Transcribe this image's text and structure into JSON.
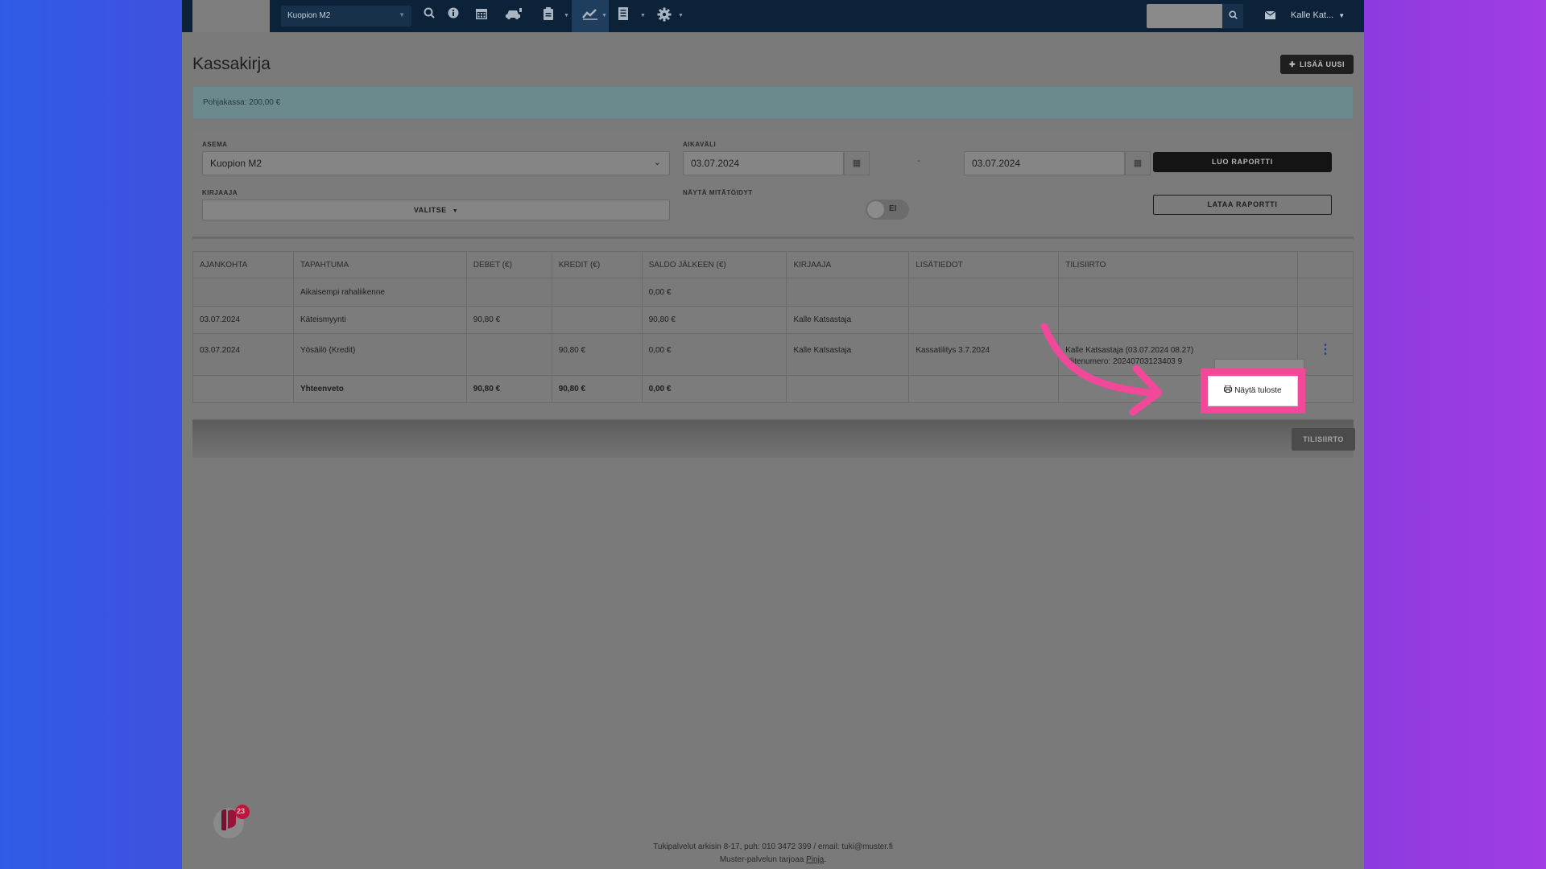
{
  "topnav": {
    "station": "Kuopion M2",
    "user": "Kalle Kat...",
    "icons": [
      "search-icon",
      "info-icon",
      "calendar-icon",
      "car-icon",
      "clipboard-icon",
      "chart-icon",
      "document-icon",
      "gear-icon"
    ]
  },
  "page": {
    "title": "Kassakirja",
    "add_button": "LISÄÄ UUSI",
    "info": "Pohjakassa: 200,00 €"
  },
  "filters": {
    "asema_label": "ASEMA",
    "asema_value": "Kuopion M2",
    "aikavali_label": "AIKAVÄLI",
    "date_from": "03.07.2024",
    "date_to": "03.07.2024",
    "dash": "-",
    "kirjaaja_label": "KIRJAAJA",
    "kirjaaja_value": "VALITSE",
    "nayta_label": "NÄYTÄ MITÄTÖIDYT",
    "toggle_value": "EI",
    "luo_button": "LUO RAPORTTI",
    "lataa_button": "LATAA RAPORTTI"
  },
  "table": {
    "headers": [
      "AJANKOHTA",
      "TAPAHTUMA",
      "DEBET (€)",
      "KREDIT (€)",
      "SALDO JÄLKEEN (€)",
      "KIRJAAJA",
      "LISÄTIEDOT",
      "TILISIIRTO"
    ],
    "rows": [
      {
        "ajankohta": "",
        "tapahtuma": "Aikaisempi rahaliikenne",
        "debet": "",
        "kredit": "",
        "saldo": "0,00 €",
        "kirjaaja": "",
        "lisatiedot": "",
        "tilisiirto": ""
      },
      {
        "ajankohta": "03.07.2024",
        "tapahtuma": "Käteismyynti",
        "debet": "90,80 €",
        "kredit": "",
        "saldo": "90,80 €",
        "kirjaaja": "Kalle Katsastaja",
        "lisatiedot": "",
        "tilisiirto": ""
      },
      {
        "ajankohta": "03.07.2024",
        "tapahtuma": "Yösäilö (Kredit)",
        "debet": "",
        "kredit": "90,80 €",
        "saldo": "0,00 €",
        "kirjaaja": "Kalle Katsastaja",
        "lisatiedot": "Kassatilitys 3.7.2024",
        "tilisiirto": "Kalle Katsastaja (03.07.2024 08.27)",
        "tilisiirto2": "Viitenumero: 20240703123403 9"
      }
    ],
    "summary": {
      "label": "Yhteenveto",
      "debet": "90,80 €",
      "kredit": "90,80 €",
      "saldo": "0,00 €"
    }
  },
  "footer": {
    "tilisiirto_button": "TILISIIRTO",
    "support_line": "Tukipalvelut arkisin 8-17, puh: 010 3472 399 / email: tuki@muster.fi",
    "provider_prefix": "Muster-palvelun tarjoaa ",
    "provider_link": "Pinja",
    "provider_suffix": "."
  },
  "popup": {
    "print_label": "Näytä tuloste",
    "highlight_color": "#f2489a"
  },
  "chat": {
    "badge_count": "23"
  }
}
